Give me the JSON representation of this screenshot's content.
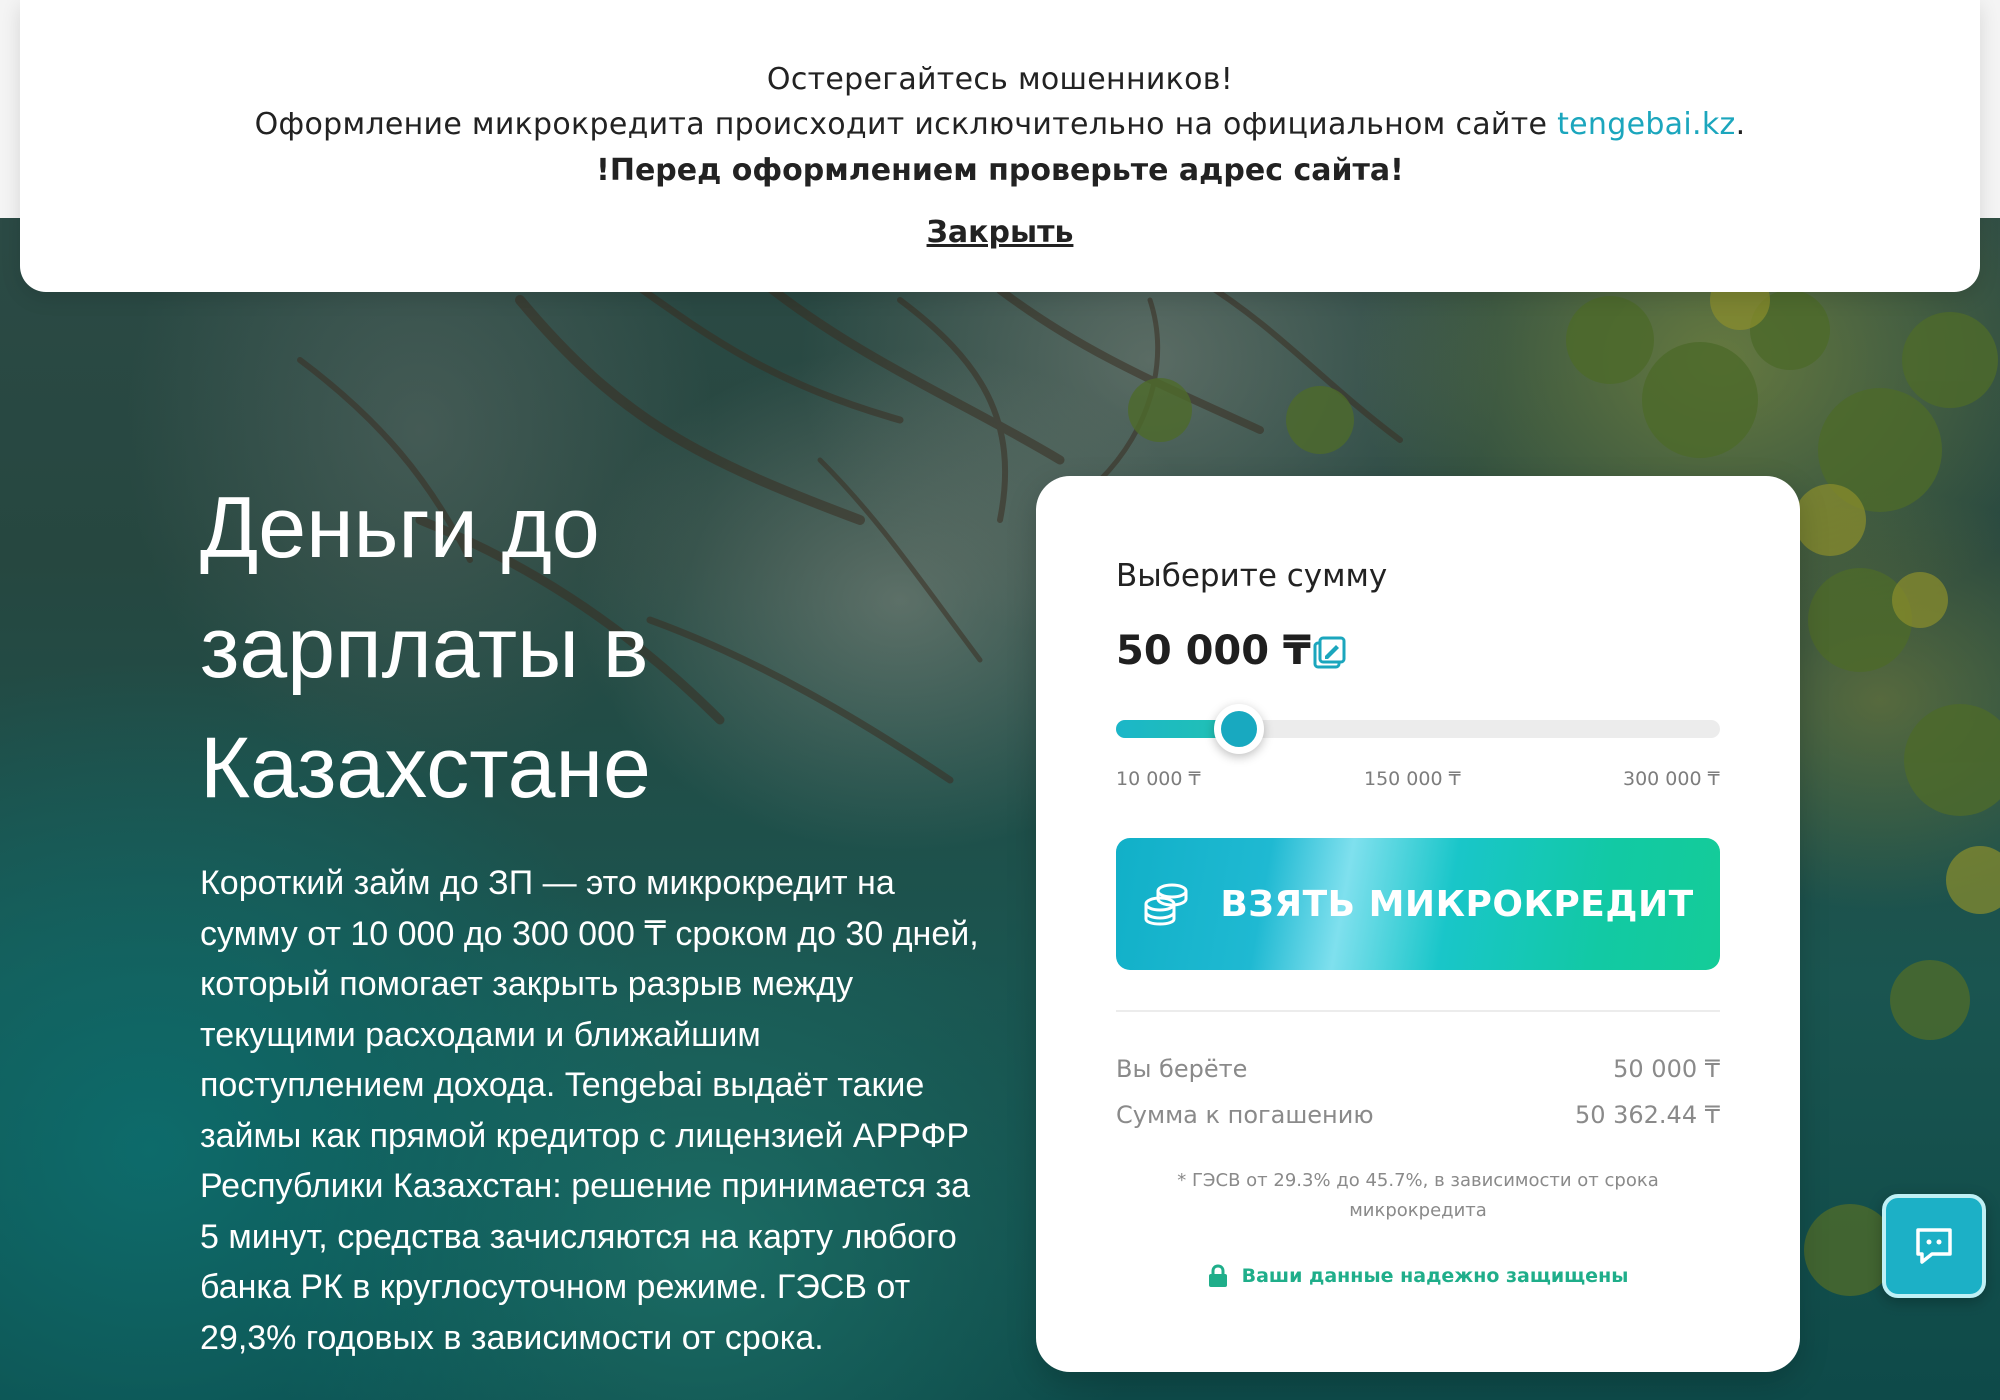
{
  "banner": {
    "line1": "Остерегайтесь мошенников!",
    "line2_text": "Оформление микрокредита происходит исключительно на официальном сайте ",
    "line2_link": "tengebai.kz",
    "line2_end": ".",
    "line3": "!Перед оформлением проверьте адрес сайта!",
    "close": "Закрыть"
  },
  "hero": {
    "title": "Деньги до зарплаты в Казахстане",
    "description": "Короткий займ до ЗП — это микрокредит на сумму от 10 000 до 300 000 ₸ сроком до 30 дней, который помогает закрыть разрыв между текущими расходами и ближайшим поступлением дохода. Tengebai выдаёт такие займы как прямой кредитор с лицензией АРРФР Республики Казахстан: решение принимается за 5 минут, средства зачисляются на карту любого банка РК в круглосуточном режиме. ГЭСВ от 29,3% годовых в зависимости от срока."
  },
  "calculator": {
    "label": "Выберите сумму",
    "amount": "50 000 ₸",
    "slider": {
      "min": 10000,
      "max": 300000,
      "value": 50000
    },
    "ticks": [
      "10 000 ₸",
      "150 000 ₸",
      "300 000 ₸"
    ],
    "cta_label": "ВЗЯТЬ МИКРОКРЕДИТ",
    "rows": [
      {
        "label": "Вы берёте",
        "value": "50 000 ₸"
      },
      {
        "label": "Сумма к погашению",
        "value": "50 362.44 ₸"
      }
    ],
    "note": "* ГЭСВ от 29.3% до 45.7%, в зависимости от срока микрокредита",
    "secure": "Ваши данные надежно защищены"
  },
  "colors": {
    "accent": "#1ba6bd",
    "cta_start": "#11b0c8",
    "cta_end": "#14cc98",
    "secure_green": "#1fae8a"
  },
  "icons": {
    "edit": "edit-icon",
    "coins": "coins-icon",
    "lock": "lock-icon",
    "chat": "chat-icon"
  }
}
